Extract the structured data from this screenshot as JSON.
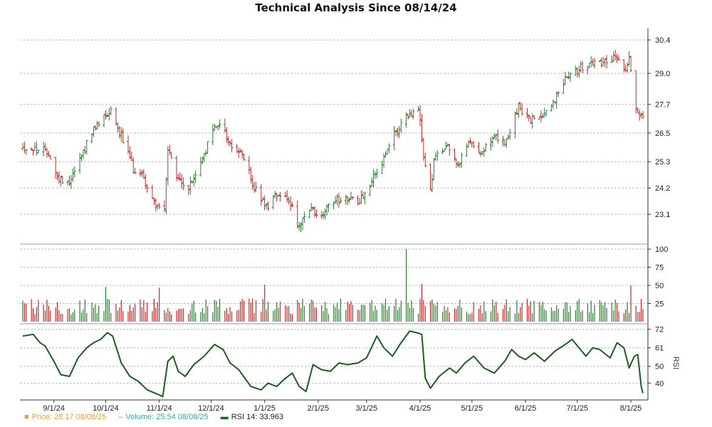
{
  "chart_data": {
    "title": "Technical Analysis Since 08/14/24",
    "type": "line",
    "x_tick_labels": [
      "9/1/24",
      "10/1/24",
      "11/1/24",
      "12/1/24",
      "1/1/25",
      "2/1/25",
      "3/1/25",
      "4/1/25",
      "5/1/25",
      "6/1/25",
      "7/1/25",
      "8/1/25"
    ],
    "colors": {
      "up": "#2e7d32",
      "down": "#c62828",
      "rsi": "#1b5e20",
      "grid": "#bdbdbd"
    },
    "panels": [
      {
        "name": "price",
        "type": "ohlc",
        "ylim": [
          22.0,
          30.7
        ],
        "yticks": [
          23.1,
          24.2,
          25.3,
          26.5,
          27.7,
          29.0,
          30.4
        ],
        "ytick_labels": [
          "23.1",
          "24.2",
          "25.3",
          "26.5",
          "27.7",
          "29.0",
          "30.4"
        ],
        "trend": [
          [
            "8/14/24",
            25.9
          ],
          [
            "8/22/24",
            25.8
          ],
          [
            "8/29/24",
            25.7
          ],
          [
            "9/3/24",
            24.6
          ],
          [
            "9/10/24",
            24.5
          ],
          [
            "9/17/24",
            25.6
          ],
          [
            "9/24/24",
            26.6
          ],
          [
            "10/1/24",
            27.3
          ],
          [
            "10/4/24",
            27.5
          ],
          [
            "10/10/24",
            26.4
          ],
          [
            "10/17/24",
            25.0
          ],
          [
            "10/22/24",
            24.8
          ],
          [
            "10/28/24",
            23.7
          ],
          [
            "11/4/24",
            23.2
          ],
          [
            "11/6/24",
            25.8
          ],
          [
            "11/11/24",
            24.6
          ],
          [
            "11/18/24",
            24.2
          ],
          [
            "11/25/24",
            25.2
          ],
          [
            "12/2/24",
            26.6
          ],
          [
            "12/6/24",
            27.0
          ],
          [
            "12/12/24",
            26.0
          ],
          [
            "12/19/24",
            25.6
          ],
          [
            "12/26/24",
            24.2
          ],
          [
            "1/2/25",
            23.4
          ],
          [
            "1/8/25",
            24.0
          ],
          [
            "1/15/25",
            23.8
          ],
          [
            "1/21/25",
            22.5
          ],
          [
            "1/27/25",
            23.3
          ],
          [
            "2/3/25",
            23.0
          ],
          [
            "2/10/25",
            23.7
          ],
          [
            "2/17/25",
            23.8
          ],
          [
            "2/24/25",
            23.6
          ],
          [
            "3/3/25",
            24.4
          ],
          [
            "3/10/25",
            25.2
          ],
          [
            "3/17/25",
            26.4
          ],
          [
            "3/24/25",
            27.1
          ],
          [
            "3/31/25",
            27.5
          ],
          [
            "4/4/25",
            25.0
          ],
          [
            "4/7/25",
            24.1
          ],
          [
            "4/9/25",
            25.3
          ],
          [
            "4/16/25",
            26.1
          ],
          [
            "4/23/25",
            25.2
          ],
          [
            "4/30/25",
            26.1
          ],
          [
            "5/7/25",
            25.7
          ],
          [
            "5/14/25",
            26.3
          ],
          [
            "5/21/25",
            26.1
          ],
          [
            "5/28/25",
            27.6
          ],
          [
            "6/4/25",
            27.0
          ],
          [
            "6/11/25",
            27.3
          ],
          [
            "6/18/25",
            27.9
          ],
          [
            "6/25/25",
            29.0
          ],
          [
            "7/2/25",
            29.2
          ],
          [
            "7/9/25",
            29.4
          ],
          [
            "7/16/25",
            29.5
          ],
          [
            "7/23/25",
            29.7
          ],
          [
            "7/28/25",
            29.0
          ],
          [
            "7/31/25",
            29.8
          ],
          [
            "8/4/25",
            27.5
          ],
          [
            "8/8/25",
            27.1
          ]
        ]
      },
      {
        "name": "volume",
        "type": "bar",
        "ylim": [
          0,
          100
        ],
        "yticks": [
          25,
          50,
          75,
          100
        ],
        "ytick_labels": [
          "25",
          "50",
          "75",
          "100"
        ],
        "spikes": [
          [
            "3/24/25",
            100
          ],
          [
            "8/1/25",
            50
          ],
          [
            "4/2/25",
            52
          ],
          [
            "1/1/25",
            51
          ],
          [
            "10/1/24",
            48
          ],
          [
            "11/1/24",
            47
          ]
        ]
      },
      {
        "name": "rsi",
        "type": "line",
        "ylabel": "RSI",
        "ylim": [
          30,
          74
        ],
        "yticks": [
          40,
          50,
          61,
          72
        ],
        "ytick_labels": [
          "40",
          "50",
          "61",
          "72"
        ],
        "series": [
          [
            "8/14/24",
            68
          ],
          [
            "8/20/24",
            69
          ],
          [
            "8/24/24",
            64
          ],
          [
            "8/27/24",
            62
          ],
          [
            "9/1/24",
            53
          ],
          [
            "9/5/24",
            45
          ],
          [
            "9/10/24",
            44
          ],
          [
            "9/15/24",
            55
          ],
          [
            "9/20/24",
            61
          ],
          [
            "9/24/24",
            64
          ],
          [
            "9/28/24",
            66
          ],
          [
            "10/2/24",
            70
          ],
          [
            "10/5/24",
            68
          ],
          [
            "10/10/24",
            52
          ],
          [
            "10/15/24",
            44
          ],
          [
            "10/20/24",
            41
          ],
          [
            "10/25/24",
            36
          ],
          [
            "11/1/24",
            33
          ],
          [
            "11/3/24",
            32
          ],
          [
            "11/6/24",
            53
          ],
          [
            "11/9/24",
            56
          ],
          [
            "11/12/24",
            47
          ],
          [
            "11/16/24",
            44
          ],
          [
            "11/21/24",
            51
          ],
          [
            "11/27/24",
            56
          ],
          [
            "12/3/24",
            63
          ],
          [
            "12/8/24",
            60
          ],
          [
            "12/12/24",
            52
          ],
          [
            "12/17/24",
            48
          ],
          [
            "12/24/24",
            38
          ],
          [
            "12/30/24",
            36
          ],
          [
            "1/3/25",
            40
          ],
          [
            "1/8/25",
            38
          ],
          [
            "1/12/25",
            42
          ],
          [
            "1/17/25",
            46
          ],
          [
            "1/21/25",
            38
          ],
          [
            "1/25/25",
            35
          ],
          [
            "1/29/25",
            51
          ],
          [
            "2/3/25",
            48
          ],
          [
            "2/8/25",
            47
          ],
          [
            "2/13/25",
            52
          ],
          [
            "2/18/25",
            51
          ],
          [
            "2/24/25",
            52
          ],
          [
            "3/1/25",
            55
          ],
          [
            "3/7/25",
            68
          ],
          [
            "3/11/25",
            61
          ],
          [
            "3/16/25",
            56
          ],
          [
            "3/21/25",
            64
          ],
          [
            "3/26/25",
            71
          ],
          [
            "3/30/25",
            70
          ],
          [
            "4/2/25",
            69
          ],
          [
            "4/4/25",
            43
          ],
          [
            "4/7/25",
            37
          ],
          [
            "4/12/25",
            44
          ],
          [
            "4/18/25",
            49
          ],
          [
            "4/22/25",
            46
          ],
          [
            "4/27/25",
            52
          ],
          [
            "5/2/25",
            56
          ],
          [
            "5/8/25",
            49
          ],
          [
            "5/14/25",
            46
          ],
          [
            "5/20/25",
            53
          ],
          [
            "5/24/25",
            60
          ],
          [
            "5/28/25",
            56
          ],
          [
            "6/1/25",
            54
          ],
          [
            "6/6/25",
            58
          ],
          [
            "6/12/25",
            53
          ],
          [
            "6/18/25",
            59
          ],
          [
            "6/24/25",
            63
          ],
          [
            "6/28/25",
            66
          ],
          [
            "7/2/25",
            61
          ],
          [
            "7/6/25",
            56
          ],
          [
            "7/10/25",
            61
          ],
          [
            "7/14/25",
            60
          ],
          [
            "7/20/25",
            55
          ],
          [
            "7/24/25",
            64
          ],
          [
            "7/28/25",
            61
          ],
          [
            "7/31/25",
            49
          ],
          [
            "8/3/25",
            56
          ],
          [
            "8/5/25",
            57
          ],
          [
            "8/7/25",
            38
          ],
          [
            "8/8/25",
            34
          ]
        ]
      }
    ],
    "legend": [
      {
        "label": "Price: 28.17  08/08/25",
        "marker": "■"
      },
      {
        "label": "Volume: 25.54  08/08/25",
        "marker": "–"
      },
      {
        "label": "RSI 14: 33.963",
        "marker": "▬"
      }
    ]
  }
}
